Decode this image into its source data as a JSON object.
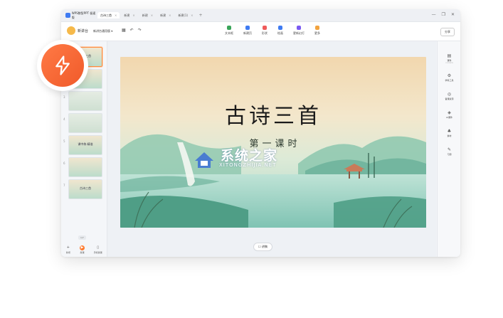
{
  "app": {
    "name": "WPS数智PPT 极速版",
    "tabs": [
      {
        "label": "古诗三首",
        "active": true
      },
      {
        "label": "新建",
        "active": false
      },
      {
        "label": "新建",
        "active": false
      },
      {
        "label": "新建",
        "active": false
      },
      {
        "label": "新建(1)",
        "active": false
      }
    ],
    "tab_add": "+",
    "window_controls": [
      "—",
      "❐",
      "✕"
    ]
  },
  "toolbar": {
    "brand": "新讲台",
    "template_select": "新讲台通用版",
    "tools": [
      {
        "label": "文本框",
        "color": "#3aa55a"
      },
      {
        "label": "新建页",
        "color": "#3f7bf2"
      },
      {
        "label": "形状",
        "color": "#ef5a5a"
      },
      {
        "label": "绘画",
        "color": "#3f7bf2"
      },
      {
        "label": "更新幻灯",
        "color": "#7a5af2"
      },
      {
        "label": "更多",
        "color": "#f2a33f"
      }
    ],
    "share": "分享"
  },
  "slides": [
    {
      "num": "1",
      "text": "古诗三首",
      "selected": true
    },
    {
      "num": "2",
      "text": "",
      "selected": false
    },
    {
      "num": "3",
      "text": "",
      "selected": false
    },
    {
      "num": "4",
      "text": "",
      "selected": false
    },
    {
      "num": "5",
      "text": "课中练·精准",
      "selected": false
    },
    {
      "num": "6",
      "text": "",
      "selected": false
    },
    {
      "num": "7",
      "text": "古诗三首",
      "selected": false
    }
  ],
  "page_counter": "1/7",
  "bottom_left": [
    {
      "label": "新增",
      "icon": "plus-icon"
    },
    {
      "label": "授课",
      "icon": "play-icon"
    },
    {
      "label": "手机授课",
      "icon": "phone-icon"
    }
  ],
  "slide": {
    "title": "古诗三首",
    "subtitle": "第一课时"
  },
  "notes_button": "☐ 讲稿",
  "right_panel": [
    {
      "label": "课件",
      "sub": "CONTENTS",
      "icon": "book-icon"
    },
    {
      "label": "学科工具",
      "sub": "",
      "icon": "tools-icon"
    },
    {
      "label": "备课资源",
      "sub": "",
      "icon": "resource-icon"
    },
    {
      "label": "AI课件",
      "sub": "",
      "icon": "ai-icon"
    },
    {
      "label": "素材",
      "sub": "",
      "icon": "material-icon"
    },
    {
      "label": "习题",
      "sub": "",
      "icon": "exercise-icon"
    }
  ],
  "watermark": {
    "cn": "系统之家",
    "en": "XITONGZHIJIA.NET"
  }
}
